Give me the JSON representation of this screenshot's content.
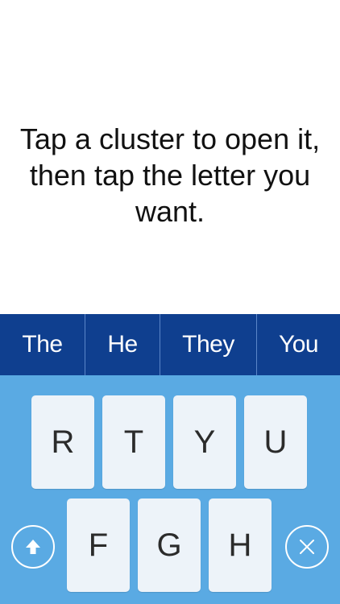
{
  "instruction": {
    "line1": "Tap a cluster to open it,",
    "line2": "then tap the letter you",
    "line3": "want."
  },
  "suggestions": [
    "The",
    "He",
    "They",
    "You"
  ],
  "keyboard": {
    "row1": [
      "R",
      "T",
      "Y",
      "U"
    ],
    "row2": [
      "F",
      "G",
      "H"
    ],
    "shift_icon": "arrow-up-icon",
    "close_icon": "close-icon"
  },
  "colors": {
    "suggestion_bar": "#0f3f8f",
    "keyboard_bg": "#5aaae3",
    "key_bg": "#edf3f9"
  }
}
